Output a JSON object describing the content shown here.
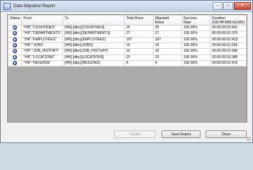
{
  "window": {
    "title": "Data Migration Report",
    "minimize_glyph": "–",
    "maximize_glyph": "□",
    "close_glyph": "✕",
    "icon": "app-window-icon"
  },
  "grid": {
    "headers": {
      "status": "Status",
      "from": "From",
      "to": "To",
      "total_rows": "Total Rows",
      "migrated_rows": "Migrated Rows",
      "success_rate": "Success Rate",
      "duration": "Duration (DD:HH:MM:SS:MS)"
    },
    "rows": [
      {
        "from": "\"HR\".\"COUNTRIES\"",
        "to": "[HR].[dbo].[COUNTRIES]",
        "total": "25",
        "migrated": "25",
        "rate": "100.00%",
        "duration": "00:00:00:01:401"
      },
      {
        "from": "\"HR\".\"DEPARTMENTS\"",
        "to": "[HR].[dbo].[DEPARTMENTS]",
        "total": "27",
        "migrated": "27",
        "rate": "100.00%",
        "duration": "00:00:00:01:370"
      },
      {
        "from": "\"HR\".\"EMPLOYEES\"",
        "to": "[HR].[dbo].[EMPLOYEES]",
        "total": "107",
        "migrated": "107",
        "rate": "100.00%",
        "duration": "00:00:00:01:433"
      },
      {
        "from": "\"HR\".\"JOBS\"",
        "to": "[HR].[dbo].[JOBS]",
        "total": "19",
        "migrated": "19",
        "rate": "100.00%",
        "duration": "00:00:00:01:655"
      },
      {
        "from": "\"HR\".\"JOB_HISTORY\"",
        "to": "[HR].[dbo].[JOB_HISTORY]",
        "total": "10",
        "migrated": "10",
        "rate": "100.00%",
        "duration": "00:00:00:01:690"
      },
      {
        "from": "\"HR\".\"LOCATIONS\"",
        "to": "[HR].[dbo].[LOCATIONS]",
        "total": "23",
        "migrated": "23",
        "rate": "100.00%",
        "duration": "00:00:00:01:385"
      },
      {
        "from": "\"HR\".\"REGIONS\"",
        "to": "[HR].[dbo].[REGIONS]",
        "total": "4",
        "migrated": "4",
        "rate": "100.00%",
        "duration": "00:00:00:01:416"
      }
    ]
  },
  "buttons": {
    "details": "Details",
    "save_report": "Save Report",
    "close": "Close"
  }
}
